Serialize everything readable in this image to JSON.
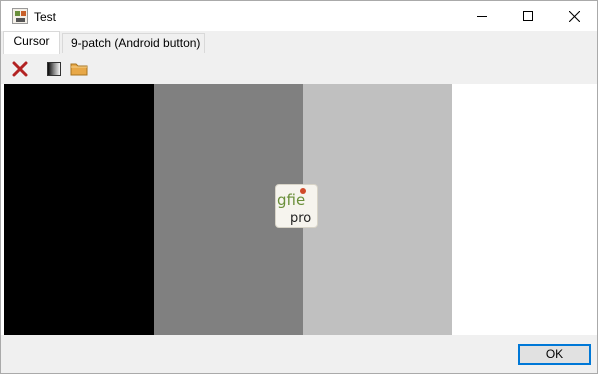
{
  "window": {
    "title": "Test",
    "controls": {
      "minimize": "minimize",
      "maximize": "maximize",
      "close": "close"
    }
  },
  "tabs": [
    {
      "label": "Cursor",
      "active": true
    },
    {
      "label": "9-patch (Android button)",
      "active": false
    }
  ],
  "toolbar": {
    "buttons": [
      {
        "name": "delete",
        "icon": "red-x-icon"
      },
      {
        "name": "background",
        "icon": "background-gradient-icon"
      },
      {
        "name": "open",
        "icon": "folder-icon"
      }
    ]
  },
  "canvas": {
    "background_bands": [
      "#000000",
      "#808080",
      "#c0c0c0",
      "#ffffff"
    ],
    "cursor_image": {
      "logo_text_top": "gfie",
      "logo_text_bottom": "pro"
    }
  },
  "footer": {
    "ok_label": "OK"
  },
  "colors": {
    "accent": "#0078d7",
    "delete_red": "#b22222",
    "folder": "#e8a847"
  }
}
